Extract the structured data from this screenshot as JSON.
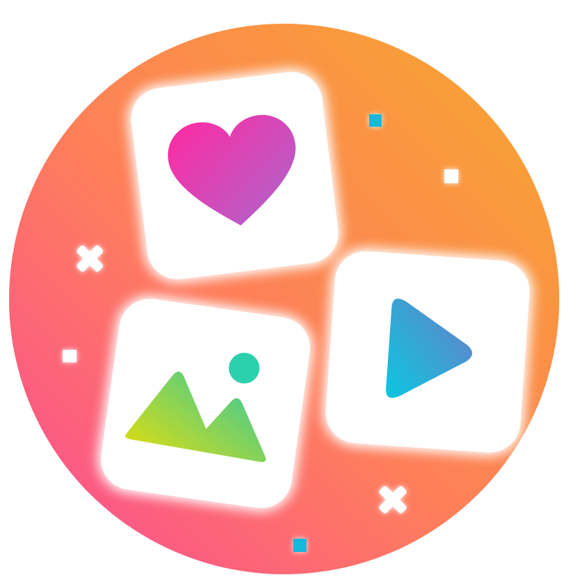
{
  "logo": {
    "tiles": [
      {
        "icon": "heart-icon"
      },
      {
        "icon": "image-icon"
      },
      {
        "icon": "play-icon"
      }
    ],
    "sparkles": [
      "sparkle-cross",
      "sparkle-cross",
      "sparkle-square",
      "sparkle-square",
      "sparkle-square",
      "sparkle-square"
    ]
  },
  "colors": {
    "background_gradient": [
      "#fb4f91",
      "#fe7f5a",
      "#f7a530"
    ],
    "heart_gradient": [
      "#ff2aa2",
      "#b660c8"
    ],
    "mountain_gradient": [
      "#d7dc16",
      "#33c9a0"
    ],
    "sun": "#2dd0ad",
    "play_gradient": [
      "#0bc7e0",
      "#6a7dc8"
    ],
    "accent_square": "#17b8dc",
    "sparkle": "#ffffff",
    "tile": "#ffffff"
  }
}
